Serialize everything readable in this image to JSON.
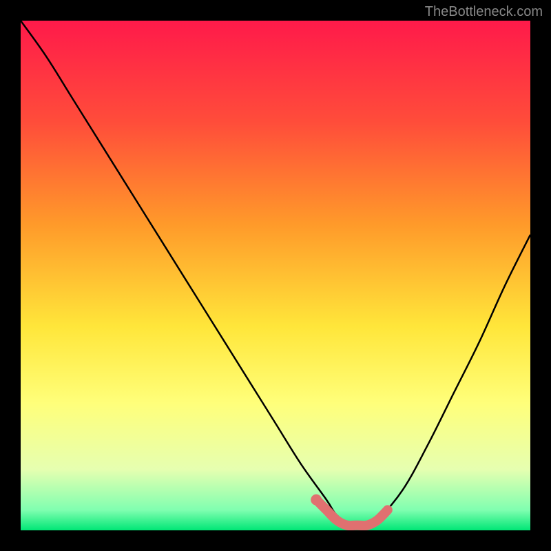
{
  "watermark": "TheBottleneck.com",
  "chart_data": {
    "type": "line",
    "title": "",
    "xlabel": "",
    "ylabel": "",
    "xlim": [
      0,
      100
    ],
    "ylim": [
      0,
      100
    ],
    "gradient_stops": [
      {
        "offset": 0,
        "color": "#ff1a4a"
      },
      {
        "offset": 20,
        "color": "#ff4d3a"
      },
      {
        "offset": 40,
        "color": "#ff9a2a"
      },
      {
        "offset": 60,
        "color": "#ffe63a"
      },
      {
        "offset": 75,
        "color": "#ffff7a"
      },
      {
        "offset": 88,
        "color": "#e6ffb0"
      },
      {
        "offset": 96,
        "color": "#80ffb0"
      },
      {
        "offset": 100,
        "color": "#00e676"
      }
    ],
    "series": [
      {
        "name": "bottleneck-curve",
        "x": [
          0,
          5,
          10,
          15,
          20,
          25,
          30,
          35,
          40,
          45,
          50,
          55,
          60,
          62,
          65,
          68,
          70,
          75,
          80,
          85,
          90,
          95,
          100
        ],
        "y": [
          100,
          93,
          85,
          77,
          69,
          61,
          53,
          45,
          37,
          29,
          21,
          13,
          6,
          3,
          1,
          1,
          2,
          8,
          17,
          27,
          37,
          48,
          58
        ]
      }
    ],
    "highlight_segment": {
      "name": "optimal-zone",
      "color": "#e07070",
      "x": [
        58,
        60,
        62,
        64,
        66,
        68,
        70,
        72
      ],
      "y": [
        6,
        4,
        2,
        1,
        1,
        1,
        2,
        4
      ]
    }
  }
}
